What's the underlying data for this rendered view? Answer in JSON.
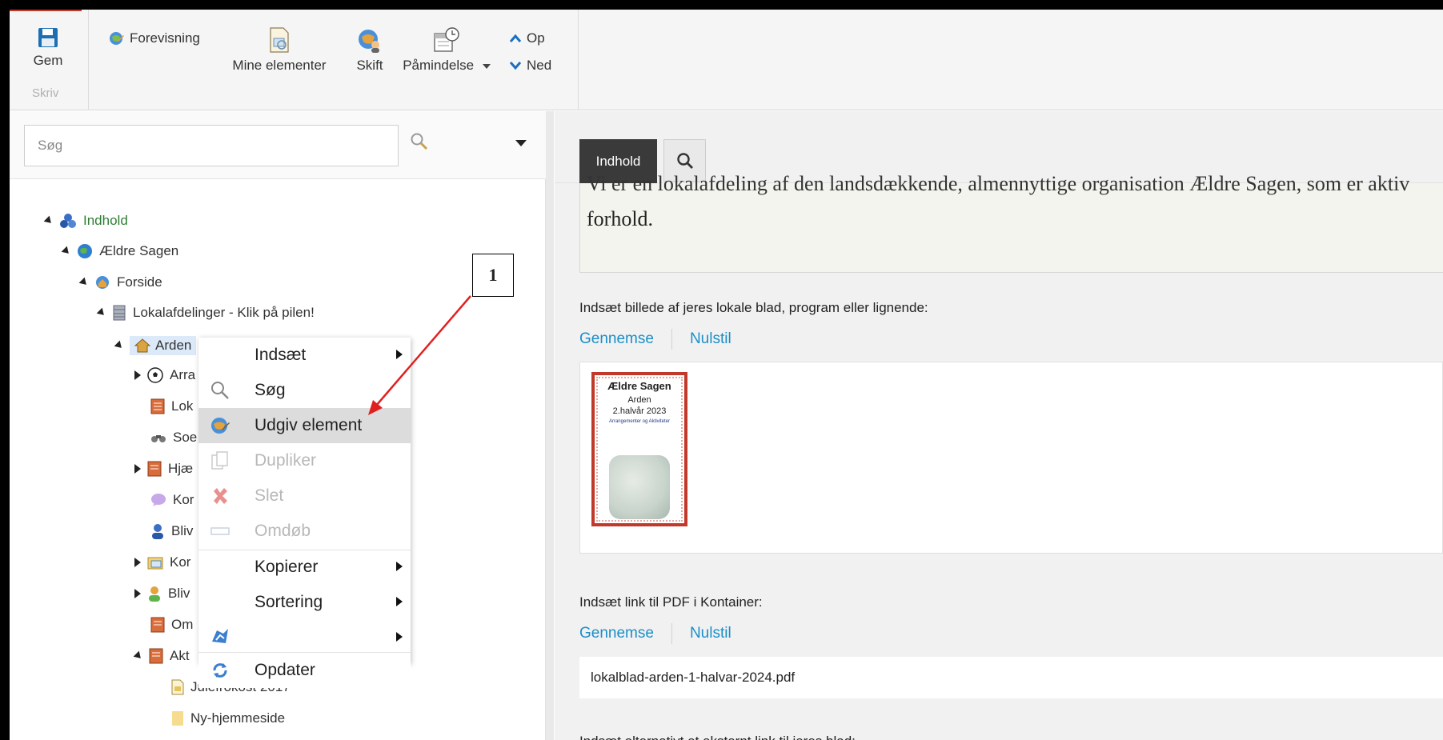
{
  "ribbon": {
    "save_label": "Gem",
    "write_group_label": "Skriv",
    "preview_label": "Forevisning",
    "my_items_label": "Mine elementer",
    "switch_label": "Skift",
    "reminder_label": "Påmindelse",
    "up_label": "Op",
    "down_label": "Ned"
  },
  "search": {
    "placeholder": "Søg"
  },
  "tree": {
    "root": "Indhold",
    "site": "Ældre Sagen",
    "home": "Forside",
    "departments": "Lokalafdelinger - Klik på pilen!",
    "arden": "Arden",
    "children": [
      "Arra",
      "Lok",
      "Soe",
      "Hjæ",
      "Kor",
      "Bliv",
      "Kor",
      "Bliv",
      "Om",
      "Akt"
    ],
    "julefrokost": "Julefrokost 2017",
    "nyhjemmeside": "Ny-hjemmeside"
  },
  "context_menu": {
    "insert": "Indsæt",
    "search": "Søg",
    "publish": "Udgiv element",
    "duplicate": "Dupliker",
    "delete": "Slet",
    "rename": "Omdøb",
    "copy": "Kopierer",
    "sort": "Sortering",
    "refresh": "Opdater"
  },
  "callout": {
    "number": "1"
  },
  "editor": {
    "tab_content": "Indhold",
    "richtext_cut": "Vi er en lokalafdeling af den landsdækkende, almennyttige organisation Ældre Sagen, som er aktiv",
    "richtext_line2": "forhold.",
    "image_field_label": "Indsæt billede af jeres lokale blad, program eller lignende:",
    "browse_label": "Gennemse",
    "reset_label": "Nulstil",
    "pdf_field_label": "Indsæt link til PDF i Kontainer:",
    "pdf_browse_label": "Gennemse",
    "pdf_reset_label": "Nulstil",
    "pdf_filename": "lokalblad-arden-1-halvar-2024.pdf",
    "external_link_label": "Indsæt alternativt et eksternt link til jeres blad:"
  },
  "thumbnail": {
    "brand": "Ældre Sagen",
    "place": "Arden",
    "period": "2.halvår 2023",
    "subtitle": "Arrangementer og Aktiviteter"
  },
  "colors": {
    "accent_blue": "#1b8fc7",
    "green": "#2f7d32",
    "annotation_red": "#e02020"
  }
}
